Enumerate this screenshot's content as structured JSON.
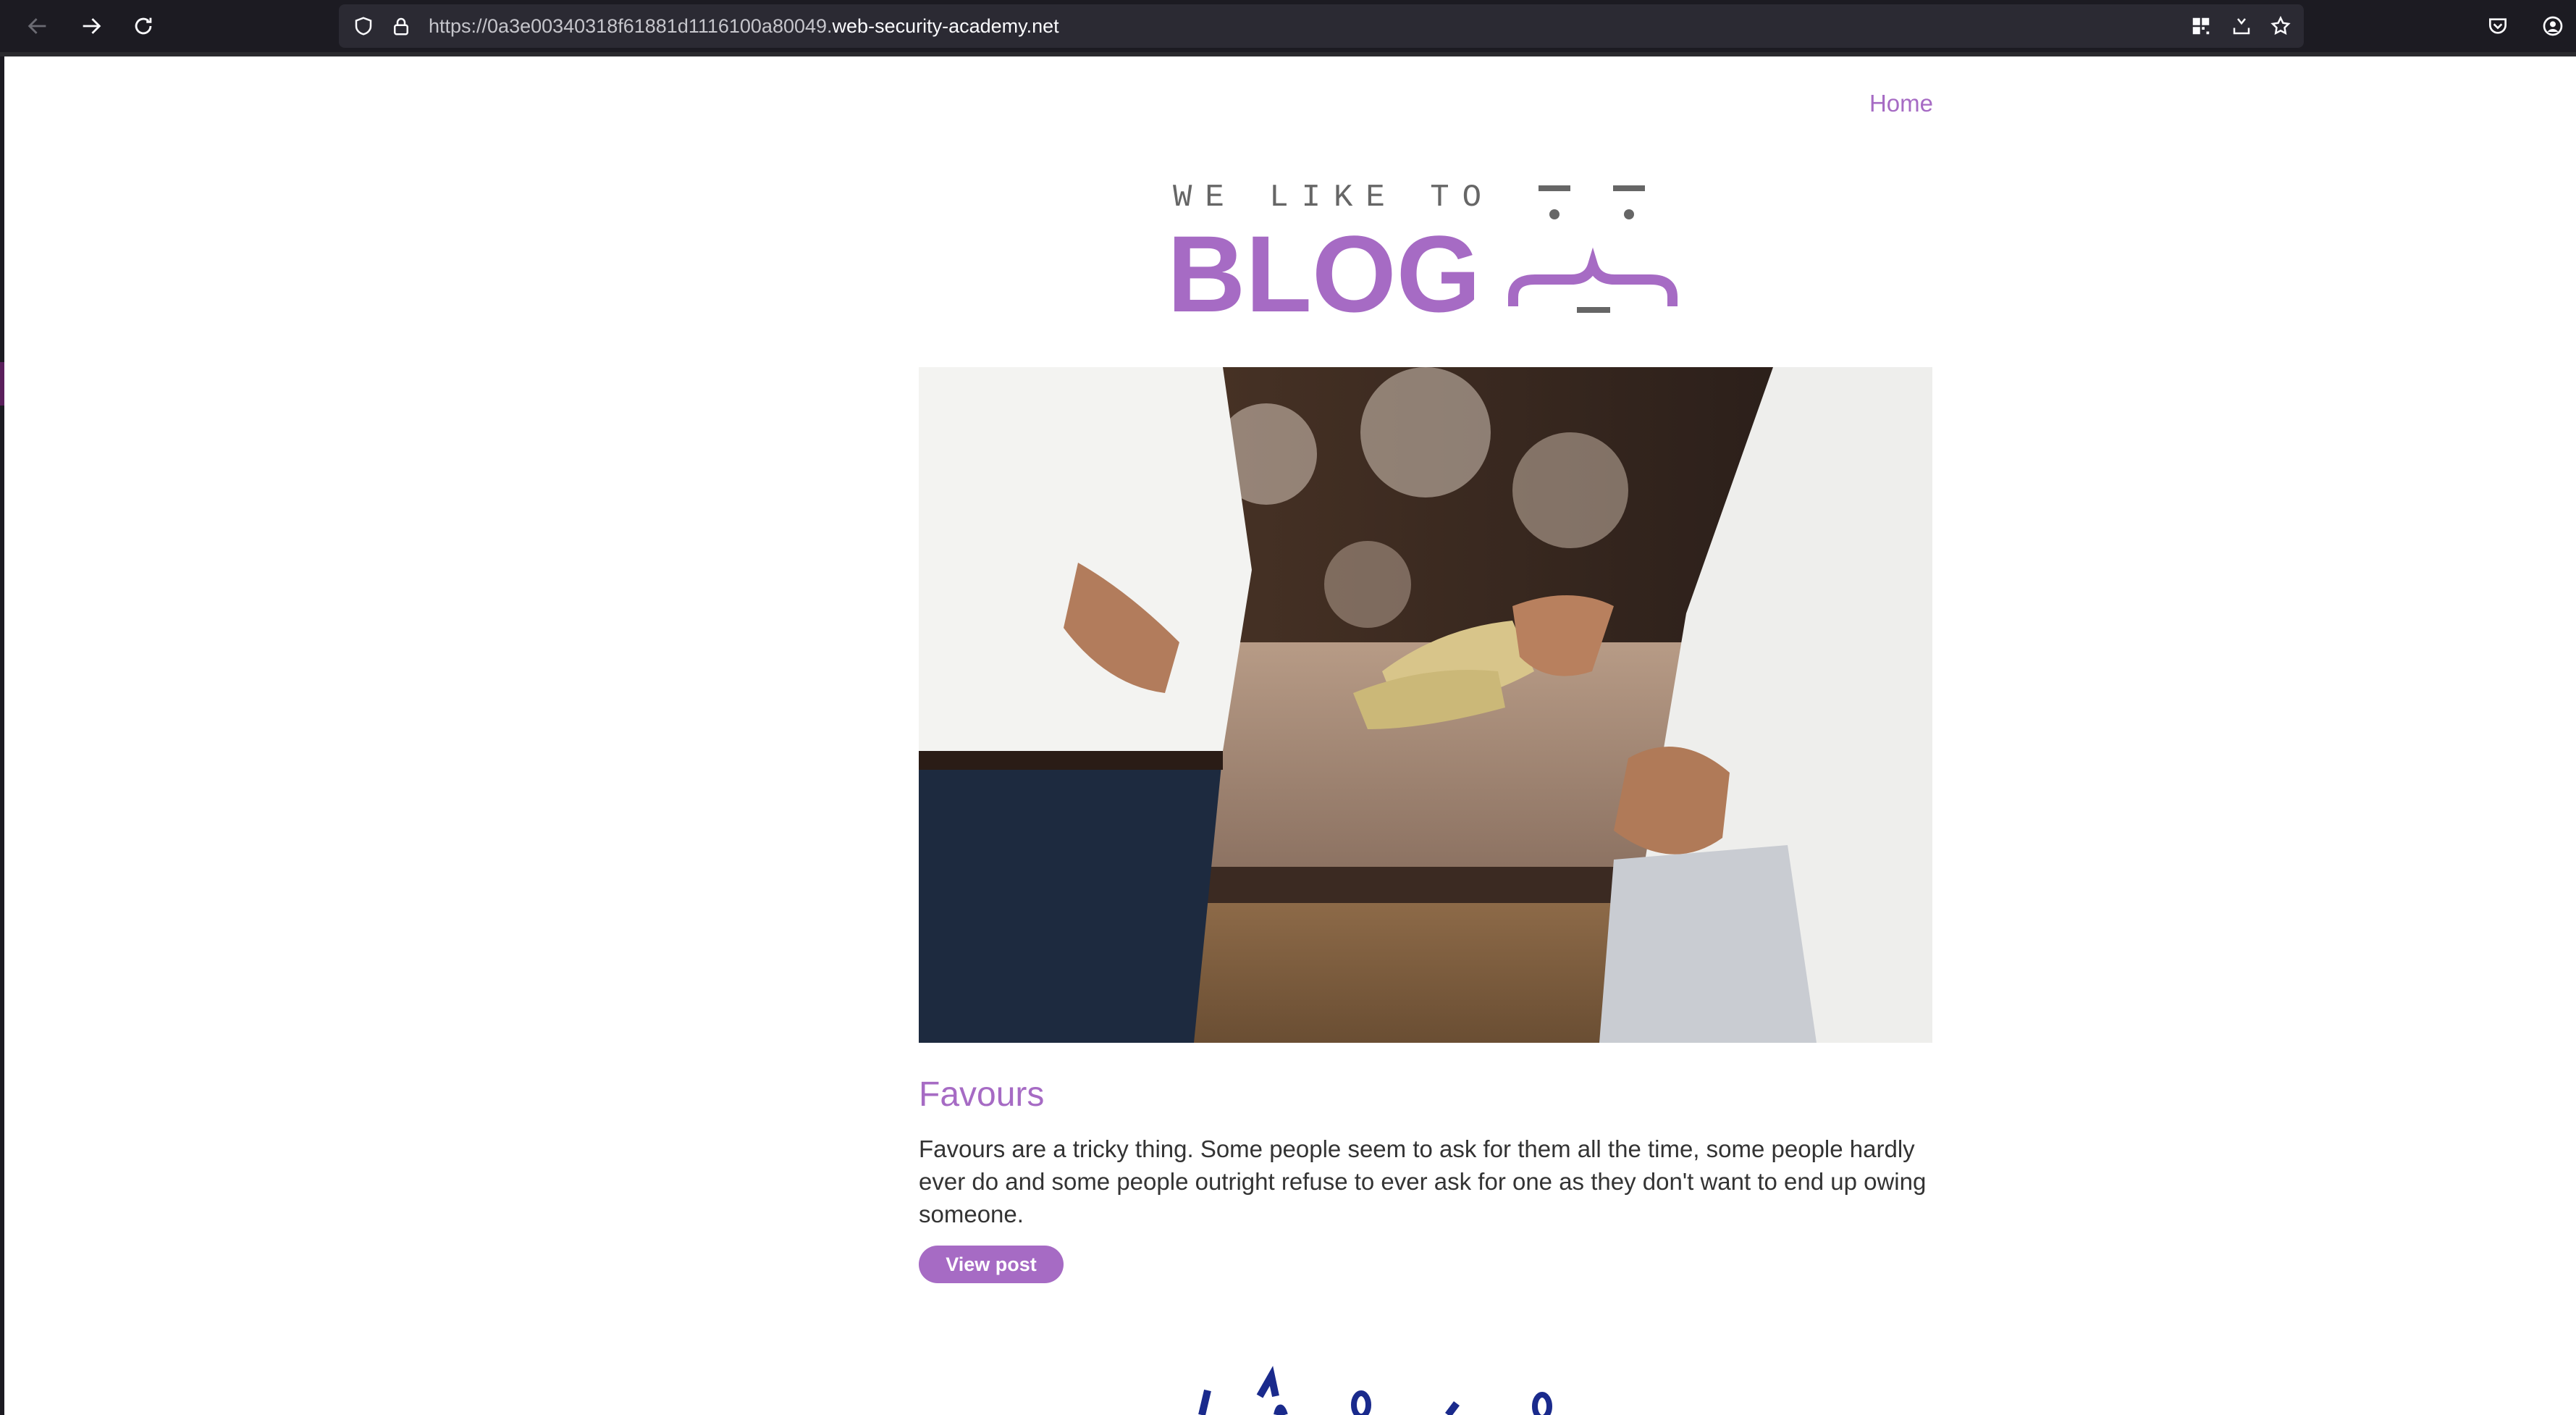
{
  "browser": {
    "url_prefix": "https://0a3e00340318f61881d1116100a80049.",
    "url_host": "web-security-academy.net"
  },
  "nav": {
    "home_label": "Home"
  },
  "logo": {
    "tagline": "WE LIKE TO",
    "word": "BLOG"
  },
  "post": {
    "title": "Favours",
    "summary": "Favours are a tricky thing. Some people seem to ask for them all the time, some people hardly ever do and some people outright refuse to ever ask for one as they don't want to end up owing someone.",
    "button_label": "View post"
  },
  "colors": {
    "accent": "#a66bc4",
    "chrome": "#1c1b22",
    "urlbar": "#2b2a33"
  }
}
